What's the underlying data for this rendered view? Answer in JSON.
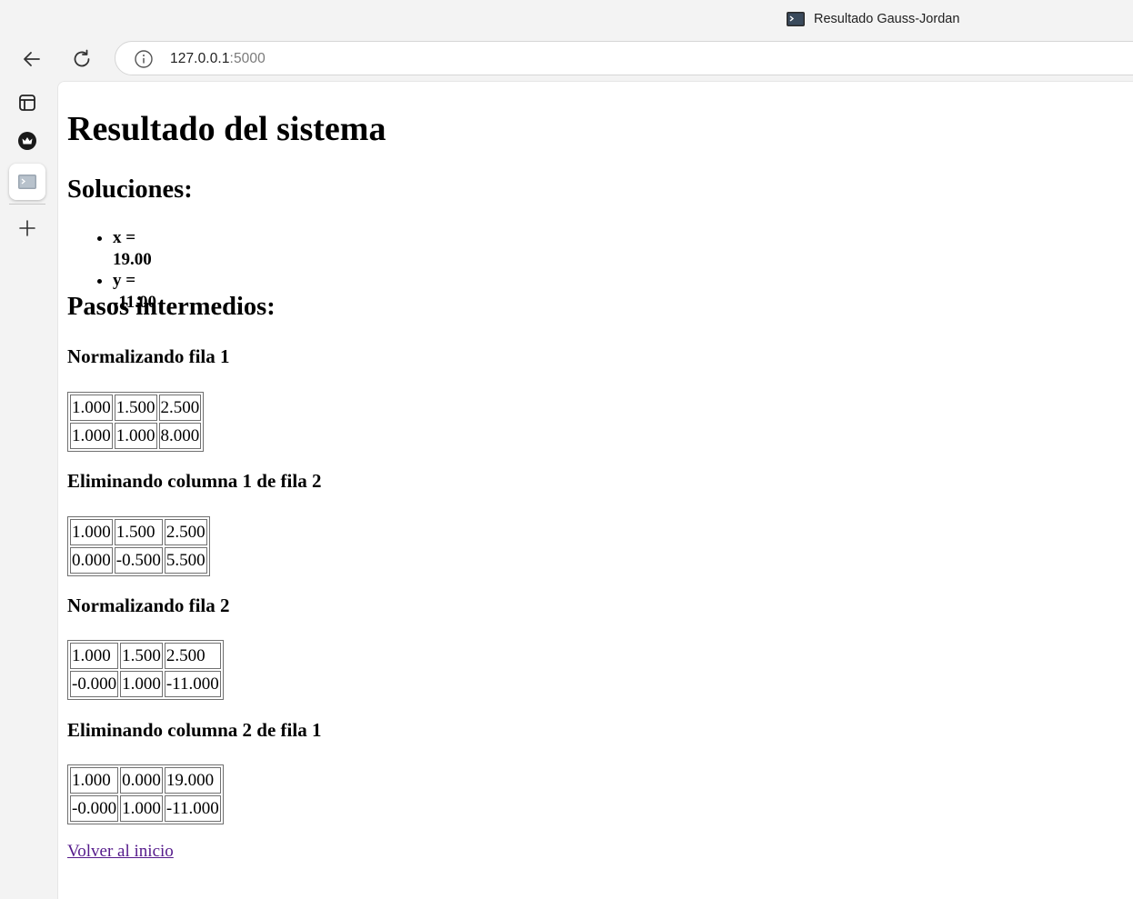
{
  "browser": {
    "tab_title": "Resultado Gauss-Jordan",
    "url_host": "127.0.0.1",
    "url_port": ":5000"
  },
  "page": {
    "title": "Resultado del sistema",
    "solutions_heading": "Soluciones:",
    "solutions": [
      "x = 19.00",
      "y = -11.00"
    ],
    "steps_heading": "Pasos intermedios:",
    "steps": [
      {
        "title": "Normalizando fila 1",
        "matrix": [
          [
            "1.000",
            "1.500",
            "2.500"
          ],
          [
            "1.000",
            "1.000",
            "8.000"
          ]
        ]
      },
      {
        "title": "Eliminando columna 1 de fila 2",
        "matrix": [
          [
            "1.000",
            "1.500",
            "2.500"
          ],
          [
            "0.000",
            "-0.500",
            "5.500"
          ]
        ]
      },
      {
        "title": "Normalizando fila 2",
        "matrix": [
          [
            "1.000",
            "1.500",
            "2.500"
          ],
          [
            "-0.000",
            "1.000",
            "-11.000"
          ]
        ]
      },
      {
        "title": "Eliminando columna 2 de fila 1",
        "matrix": [
          [
            "1.000",
            "0.000",
            "19.000"
          ],
          [
            "-0.000",
            "1.000",
            "-11.000"
          ]
        ]
      }
    ],
    "back_link": "Volver al inicio"
  },
  "icons": {
    "back": "arrow-left-icon",
    "reload": "reload-icon",
    "site_info": "info-icon",
    "tab_favicon": "terminal-icon",
    "sidebar": [
      "tab-panel-icon",
      "crown-icon",
      "terminal-icon",
      "plus-icon"
    ]
  },
  "colors": {
    "visited_link": "#551a8b",
    "chrome_bg": "#f3f3f3"
  }
}
